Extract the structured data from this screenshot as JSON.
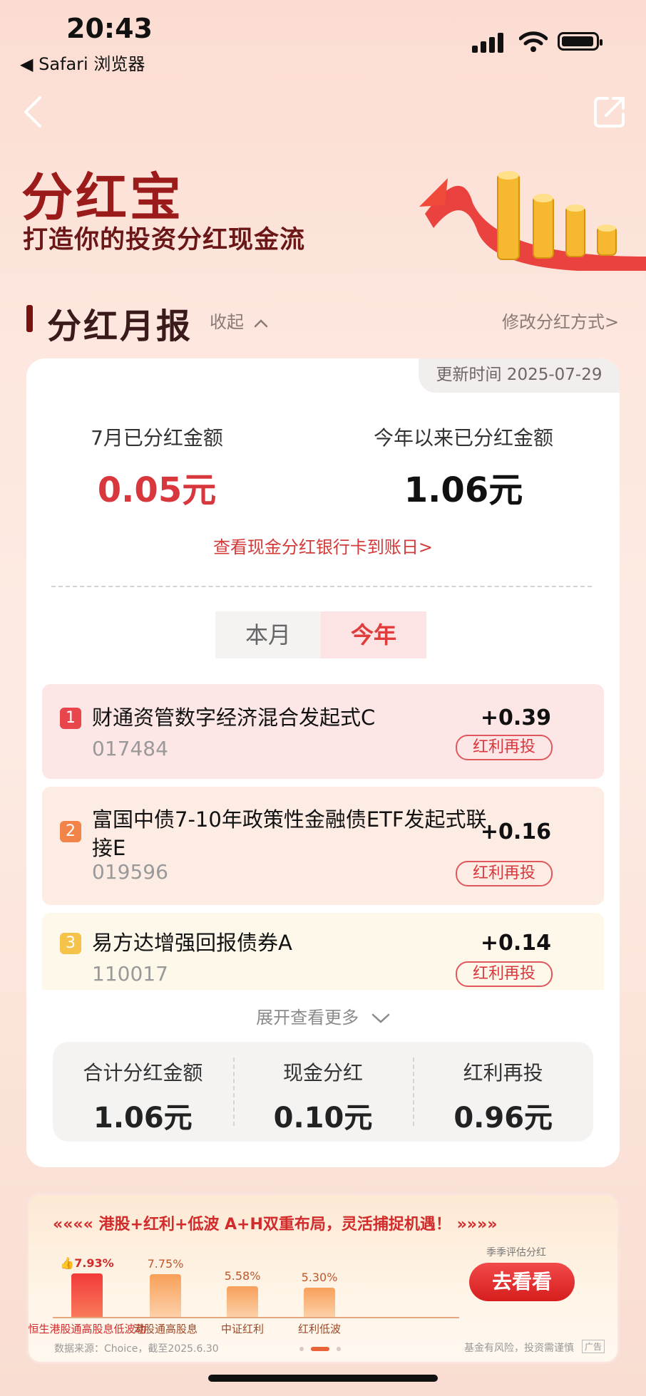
{
  "status_bar": {
    "time": "20:43",
    "back_app": "◀ Safari 浏览器"
  },
  "hero": {
    "title": "分红宝",
    "subtitle": "打造你的投资分红现金流"
  },
  "section": {
    "title": "分红月报",
    "collapse_label": "收起",
    "modify_label": "修改分红方式>"
  },
  "report": {
    "update_time": "更新时间 2025-07-29",
    "month_label": "7月已分红金额",
    "month_amount": "0.05元",
    "year_label": "今年以来已分红金额",
    "year_amount": "1.06元",
    "bank_link": "查看现金分红银行卡到账日>",
    "tabs": [
      "本月",
      "今年"
    ],
    "active_tab": "今年",
    "funds": [
      {
        "rank": "1",
        "name": "财通资管数字经济混合发起式C",
        "code": "017484",
        "value": "+0.39",
        "tag": "红利再投",
        "rank_color": "#e8454c",
        "bg": "#fde6e6"
      },
      {
        "rank": "2",
        "name": "富国中债7-10年政策性金融债ETF发起式联接E",
        "code": "019596",
        "value": "+0.16",
        "tag": "红利再投",
        "rank_color": "#f2844a",
        "bg": "#fdece3"
      },
      {
        "rank": "3",
        "name": "易方达增强回报债券A",
        "code": "110017",
        "value": "+0.14",
        "tag": "红利再投",
        "rank_color": "#f5c34a",
        "bg": "#fef8ea"
      }
    ],
    "more_label": "展开查看更多",
    "summary": [
      {
        "label": "合计分红金额",
        "value": "1.06元"
      },
      {
        "label": "现金分红",
        "value": "0.10元"
      },
      {
        "label": "红利再投",
        "value": "0.96元"
      }
    ]
  },
  "banner": {
    "headline": "«««« 港股+红利+低波  A+H双重布局，灵活捕捉机遇！ »»»»",
    "bars": [
      {
        "category": "恒生港股通高股息低波动",
        "value": "7.93%",
        "pct": 7.93,
        "thumb": "👍"
      },
      {
        "category": "港股通高股息",
        "value": "7.75%",
        "pct": 7.75
      },
      {
        "category": "中证红利",
        "value": "5.58%",
        "pct": 5.58
      },
      {
        "category": "红利低波",
        "value": "5.30%",
        "pct": 5.3
      }
    ],
    "season_label": "季季评估分红",
    "button_label": "去看看",
    "source": "数据来源：Choice，截至2025.6.30",
    "risk": "基金有风险，投资需谨慎",
    "ad": "广告"
  }
}
